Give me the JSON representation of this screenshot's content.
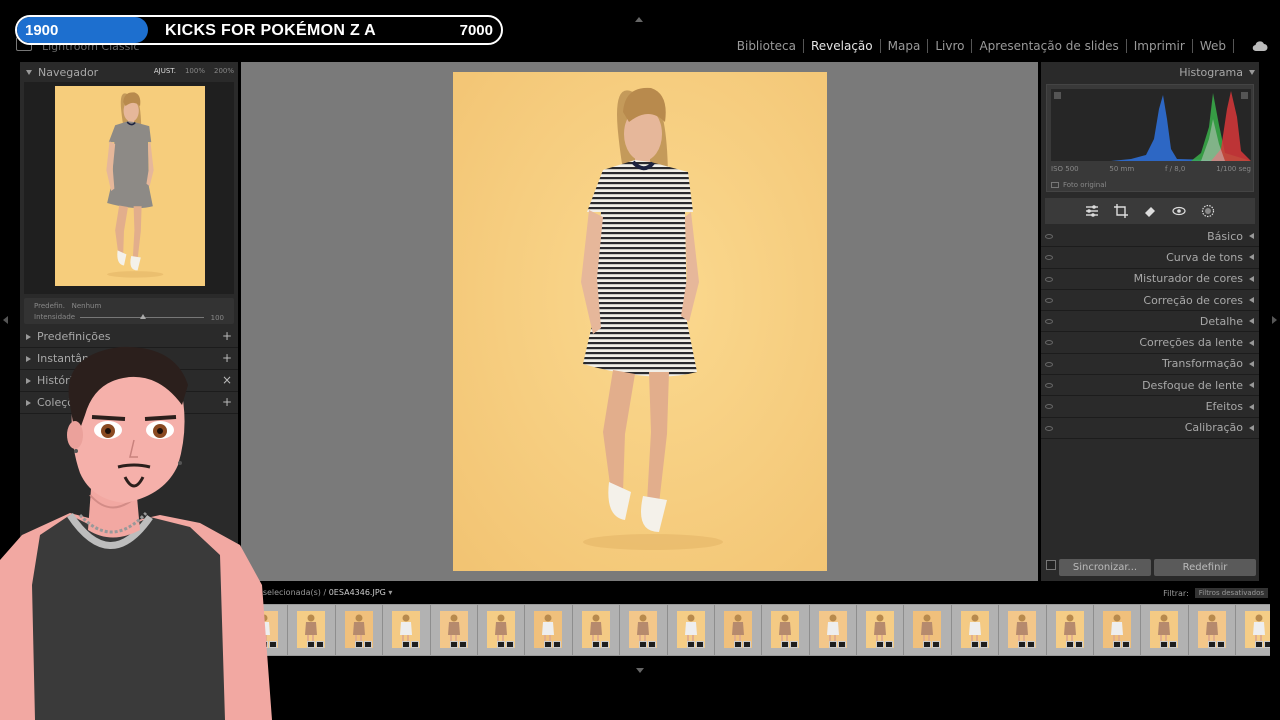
{
  "app": {
    "title": "Lightroom Classic"
  },
  "modules": [
    {
      "label": "Biblioteca",
      "active": false
    },
    {
      "label": "Revelação",
      "active": true
    },
    {
      "label": "Mapa",
      "active": false
    },
    {
      "label": "Livro",
      "active": false
    },
    {
      "label": "Apresentação de slides",
      "active": false
    },
    {
      "label": "Imprimir",
      "active": false
    },
    {
      "label": "Web",
      "active": false
    }
  ],
  "goal": {
    "current": "1900",
    "title": "KICKS FOR POKÉMON Z A",
    "target": "7000",
    "progress": 0.271,
    "fill_color": "#1d6fcf"
  },
  "left_panel": {
    "navigator": {
      "title": "Navegador",
      "zoom_options": [
        "AJUST.",
        "100%",
        "200%"
      ],
      "selected_zoom": "AJUST."
    },
    "preset": {
      "label": "Predefin.",
      "value": "Nenhum",
      "amount_label": "Intensidade",
      "amount_value": "100"
    },
    "sections": [
      {
        "label": "Predefinições",
        "action": "+"
      },
      {
        "label": "Instantâneos",
        "action": "+"
      },
      {
        "label": "Histórico",
        "action": "×"
      },
      {
        "label": "Coleções",
        "action": "+"
      }
    ]
  },
  "right_panel": {
    "histogram": {
      "title": "Histograma",
      "iso": "ISO 500",
      "focal": "50 mm",
      "aperture": "f / 8,0",
      "shutter": "1/100 seg",
      "original_label": "Foto original"
    },
    "tools": [
      "sliders-icon",
      "crop-icon",
      "eraser-icon",
      "eye-icon",
      "mask-icon"
    ],
    "sections": [
      "Básico",
      "Curva de tons",
      "Misturador de cores",
      "Correção de cores",
      "Detalhe",
      "Correções da lente",
      "Transformação",
      "Desfoque de lente",
      "Efeitos",
      "Calibração"
    ],
    "sync_button": "Sincronizar...",
    "reset_button": "Redefinir"
  },
  "filmstrip": {
    "info": "373 selecionada(s) /",
    "filename": "0ESA4346.JPG",
    "filter_label": "Filtrar:",
    "filter_value": "Filtros desativados",
    "thumbnail_count": 22
  },
  "colors": {
    "backdrop": "#f7d084",
    "panel": "#2a2a2a",
    "canvas": "#7a7a7a"
  }
}
